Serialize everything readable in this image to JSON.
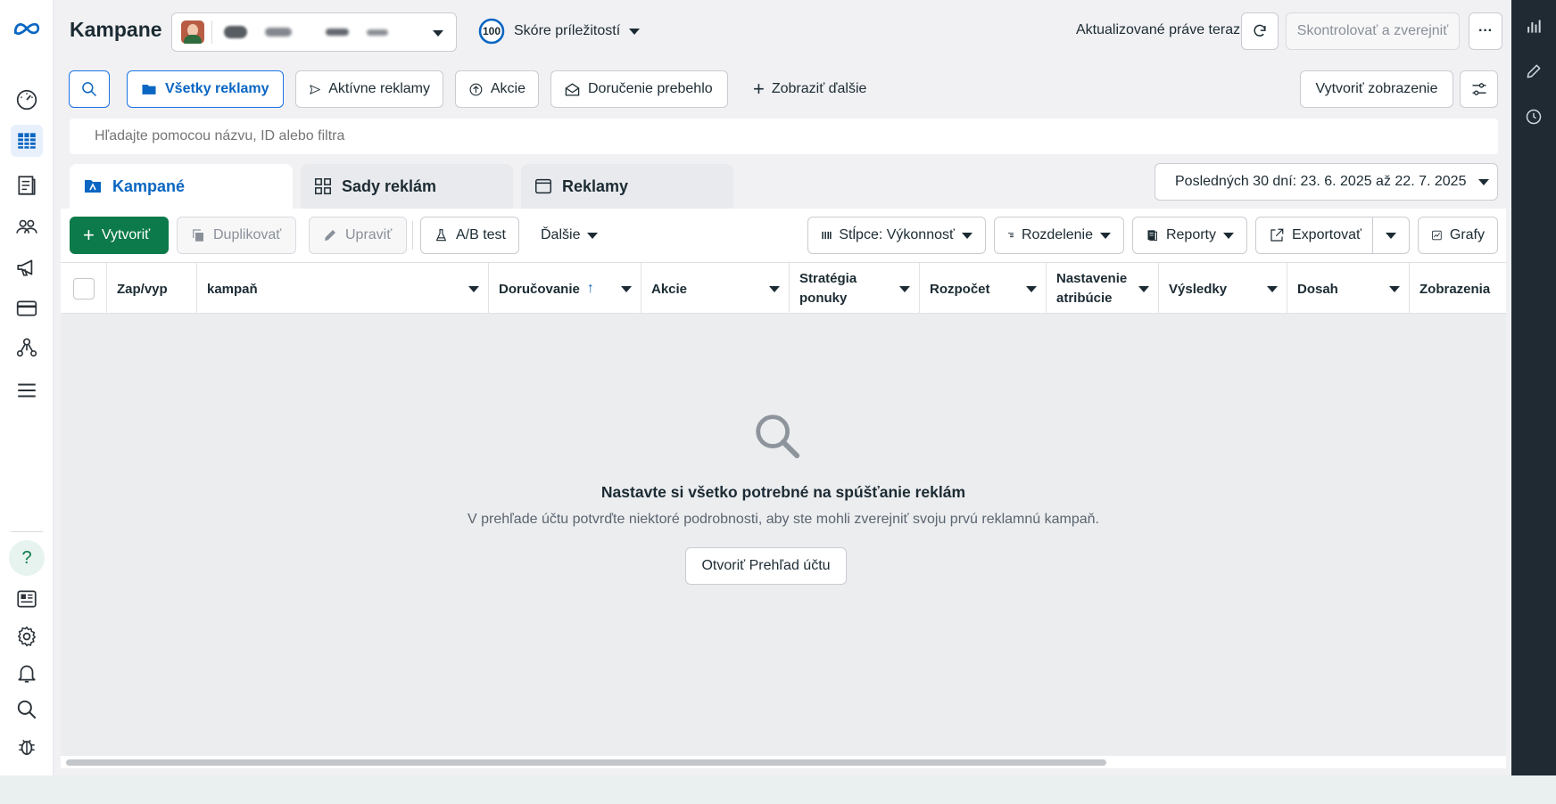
{
  "page": {
    "title": "Kampane",
    "opportunity_score_value": "100",
    "opportunity_score_label": "Skóre príležitostí",
    "updated_text": "Aktualizované práve teraz",
    "review_publish_label": "Skontrolovať a zverejniť",
    "more_label": "···"
  },
  "filters": {
    "all_ads": "Všetky reklamy",
    "active_ads": "Aktívne reklamy",
    "actions": "Akcie",
    "delivered": "Doručenie prebehlo",
    "show_more": "Zobraziť ďalšie",
    "create_view": "Vytvoriť zobrazenie"
  },
  "search": {
    "placeholder": "Hľadajte pomocou názvu, ID alebo filtra"
  },
  "tabs": [
    {
      "label": "Kampané"
    },
    {
      "label": "Sady reklám"
    },
    {
      "label": "Reklamy"
    }
  ],
  "date_range": "Posledných 30 dní: 23. 6. 2025 až 22. 7. 2025",
  "toolbar": {
    "create": "Vytvoriť",
    "duplicate": "Duplikovať",
    "edit": "Upraviť",
    "ab_test": "A/B test",
    "more": "Ďalšie",
    "columns": "Stĺpce: Výkonnosť",
    "breakdown": "Rozdelenie",
    "reports": "Reporty",
    "export": "Exportovať",
    "charts": "Grafy"
  },
  "table": {
    "columns": [
      {
        "label": "Zap/vyp"
      },
      {
        "label": "kampaň"
      },
      {
        "label": "Doručovanie"
      },
      {
        "label": "Akcie"
      },
      {
        "label": "Stratégia ponuky"
      },
      {
        "label": "Rozpočet"
      },
      {
        "label": "Nastavenie atribúcie"
      },
      {
        "label": "Výsledky"
      },
      {
        "label": "Dosah"
      },
      {
        "label": "Zobrazenia"
      }
    ]
  },
  "empty_state": {
    "title": "Nastavte si všetko potrebné na spúšťanie reklám",
    "description": "V prehľade účtu potvrďte niektoré podrobnosti, aby ste mohli zverejniť svoju prvú reklamnú kampaň.",
    "button": "Otvoriť Prehľad účtu"
  },
  "colors": {
    "meta_blue": "#0a66c2",
    "create_green": "#0c7a4a",
    "right_rail": "#1f2a33"
  }
}
